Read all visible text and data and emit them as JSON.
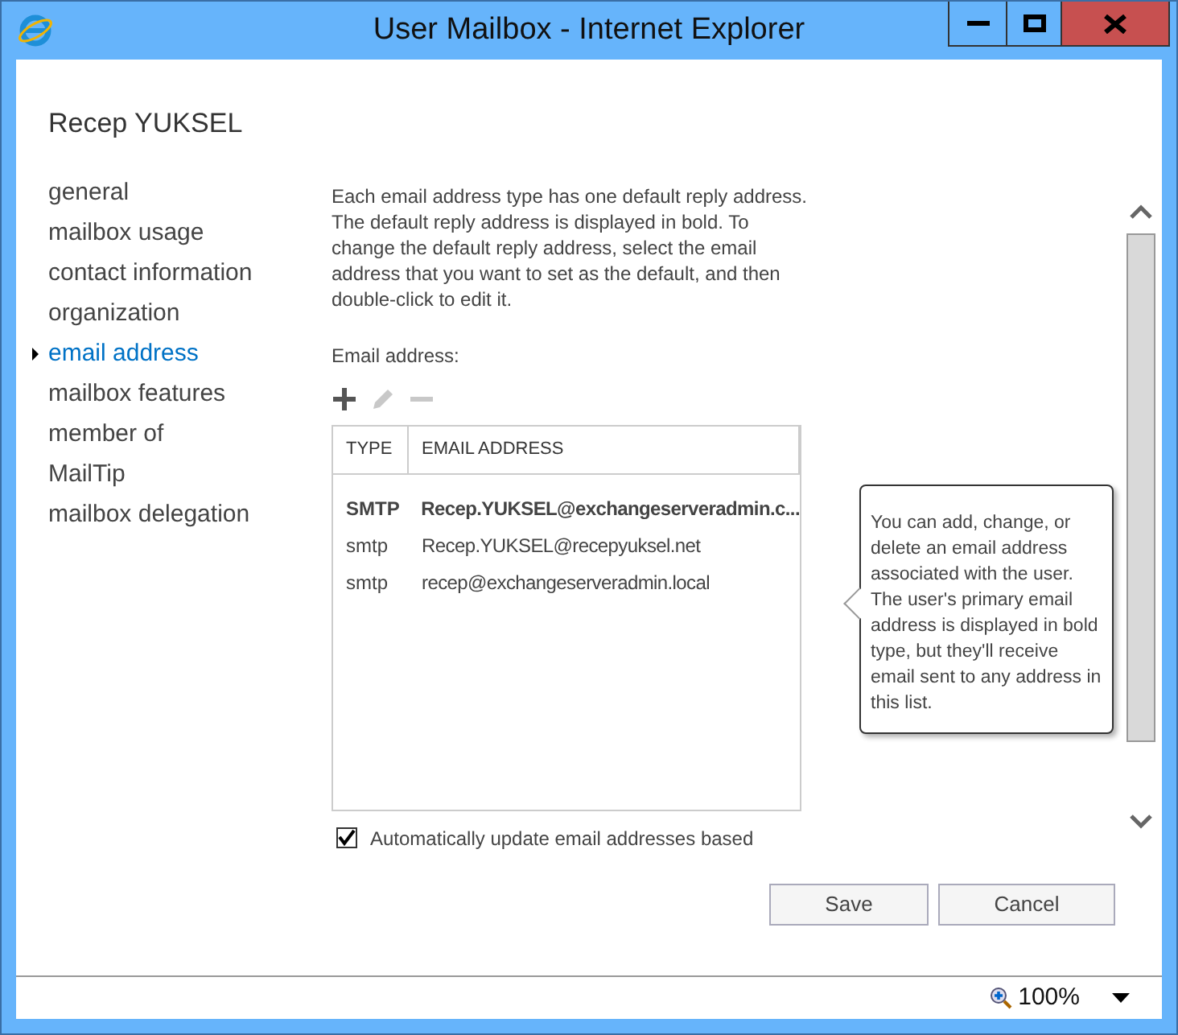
{
  "window": {
    "title": "User Mailbox - Internet Explorer"
  },
  "page_title": "Recep YUKSEL",
  "nav": [
    {
      "label": "general",
      "selected": false
    },
    {
      "label": "mailbox usage",
      "selected": false
    },
    {
      "label": "contact information",
      "selected": false
    },
    {
      "label": "organization",
      "selected": false
    },
    {
      "label": "email address",
      "selected": true
    },
    {
      "label": "mailbox features",
      "selected": false
    },
    {
      "label": "member of",
      "selected": false
    },
    {
      "label": "MailTip",
      "selected": false
    },
    {
      "label": "mailbox delegation",
      "selected": false
    }
  ],
  "intro": "Each email address type has one default reply address. The default reply address is displayed in bold. To change the default reply address, select the email address that you want to set as the default, and then double-click to edit it.",
  "list_label": "Email address:",
  "toolbar": [
    {
      "kind": "add",
      "disabled": false
    },
    {
      "kind": "edit",
      "disabled": true
    },
    {
      "kind": "remove",
      "disabled": true
    }
  ],
  "table": {
    "columns": [
      "TYPE",
      "EMAIL ADDRESS"
    ],
    "rows": [
      {
        "type": "SMTP",
        "address": "Recep.YUKSEL@exchangeserveradmin.c...",
        "bold": true
      },
      {
        "type": "smtp",
        "address": "Recep.YUKSEL@recepyuksel.net",
        "bold": false
      },
      {
        "type": "smtp",
        "address": "recep@exchangeserveradmin.local",
        "bold": false
      }
    ]
  },
  "tooltip": "You can add, change, or delete an email address associated with the user. The user's primary email address is displayed in bold type, but they'll receive email sent to any address in this list.",
  "auto_update": {
    "label": "Automatically update email addresses based",
    "checked": true
  },
  "buttons": [
    "Save",
    "Cancel"
  ],
  "status_bar": {
    "zoom": "100%"
  }
}
